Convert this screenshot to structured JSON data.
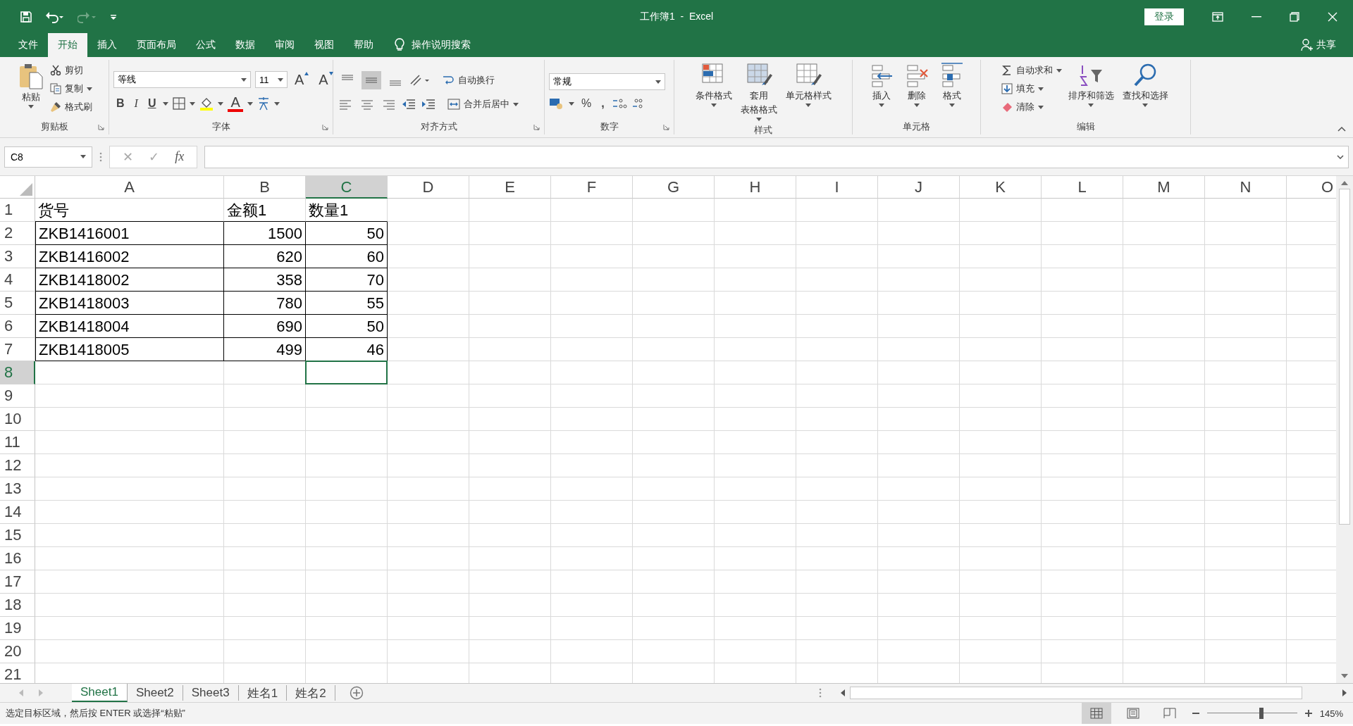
{
  "title_bar": {
    "title": "工作簿1  -  Excel",
    "sign_in": "登录"
  },
  "menu_tabs": [
    {
      "label": "文件",
      "selected": false
    },
    {
      "label": "开始",
      "selected": true
    },
    {
      "label": "插入",
      "selected": false
    },
    {
      "label": "页面布局",
      "selected": false
    },
    {
      "label": "公式",
      "selected": false
    },
    {
      "label": "数据",
      "selected": false
    },
    {
      "label": "审阅",
      "selected": false
    },
    {
      "label": "视图",
      "selected": false
    },
    {
      "label": "帮助",
      "selected": false
    }
  ],
  "tell_me": "操作说明搜索",
  "share": "共享",
  "ribbon": {
    "clipboard": {
      "label": "剪贴板",
      "paste": "粘贴",
      "cut": "剪切",
      "copy": "复制",
      "format_painter": "格式刷"
    },
    "font": {
      "label": "字体",
      "font_name": "等线",
      "font_size": "11",
      "grow": "A",
      "shrink": "A",
      "bold": "B",
      "italic": "I",
      "underline": "U",
      "font_color": "A"
    },
    "alignment": {
      "label": "对齐方式",
      "wrap_text": "自动换行",
      "merge_center": "合并后居中",
      "vertical": [
        {
          "selected": false
        },
        {
          "selected": true
        },
        {
          "selected": false
        }
      ]
    },
    "number": {
      "label": "数字",
      "format": "常规",
      "percent": "%",
      "comma": ","
    },
    "styles": {
      "label": "样式",
      "buttons": [
        {
          "lines": [
            "条件格式"
          ]
        },
        {
          "lines": [
            "套用",
            "表格格式"
          ]
        },
        {
          "lines": [
            "单元格样式"
          ]
        }
      ]
    },
    "cells": {
      "label": "单元格",
      "buttons": [
        "插入",
        "删除",
        "格式"
      ]
    },
    "editing": {
      "label": "编辑",
      "autosum": "自动求和",
      "fill": "填充",
      "clear": "清除",
      "sort_filter": "排序和筛选",
      "find_select": "查找和选择"
    }
  },
  "formula_bar": {
    "name_box": "C8",
    "cancel": "✕",
    "enter": "✓",
    "function": "fx"
  },
  "sheet": {
    "columns": [
      {
        "label": "A",
        "selected": false
      },
      {
        "label": "B",
        "selected": false
      },
      {
        "label": "C",
        "selected": true
      },
      {
        "label": "D",
        "selected": false
      },
      {
        "label": "E",
        "selected": false
      },
      {
        "label": "F",
        "selected": false
      },
      {
        "label": "G",
        "selected": false
      },
      {
        "label": "H",
        "selected": false
      },
      {
        "label": "I",
        "selected": false
      },
      {
        "label": "J",
        "selected": false
      },
      {
        "label": "K",
        "selected": false
      },
      {
        "label": "L",
        "selected": false
      },
      {
        "label": "M",
        "selected": false
      },
      {
        "label": "N",
        "selected": false
      },
      {
        "label": "O",
        "selected": false
      }
    ],
    "rows": [
      {
        "number": "1",
        "selected": false,
        "bordered": false,
        "cells": [
          {
            "text": "货号",
            "right_aligned": false
          },
          {
            "text": "金额1",
            "right_aligned": false
          },
          {
            "text": "数量1",
            "right_aligned": false
          }
        ]
      },
      {
        "number": "2",
        "selected": false,
        "bordered": true,
        "cells": [
          {
            "text": "ZKB1416001",
            "right_aligned": false
          },
          {
            "text": "1500",
            "right_aligned": true
          },
          {
            "text": "50",
            "right_aligned": true
          }
        ]
      },
      {
        "number": "3",
        "selected": false,
        "bordered": true,
        "cells": [
          {
            "text": "ZKB1416002",
            "right_aligned": false
          },
          {
            "text": "620",
            "right_aligned": true
          },
          {
            "text": "60",
            "right_aligned": true
          }
        ]
      },
      {
        "number": "4",
        "selected": false,
        "bordered": true,
        "cells": [
          {
            "text": "ZKB1418002",
            "right_aligned": false
          },
          {
            "text": "358",
            "right_aligned": true
          },
          {
            "text": "70",
            "right_aligned": true
          }
        ]
      },
      {
        "number": "5",
        "selected": false,
        "bordered": true,
        "cells": [
          {
            "text": "ZKB1418003",
            "right_aligned": false
          },
          {
            "text": "780",
            "right_aligned": true
          },
          {
            "text": "55",
            "right_aligned": true
          }
        ]
      },
      {
        "number": "6",
        "selected": false,
        "bordered": true,
        "cells": [
          {
            "text": "ZKB1418004",
            "right_aligned": false
          },
          {
            "text": "690",
            "right_aligned": true
          },
          {
            "text": "50",
            "right_aligned": true
          }
        ]
      },
      {
        "number": "7",
        "selected": false,
        "bordered": true,
        "cells": [
          {
            "text": "ZKB1418005",
            "right_aligned": false
          },
          {
            "text": "499",
            "right_aligned": true
          },
          {
            "text": "46",
            "right_aligned": true
          }
        ]
      },
      {
        "number": "8",
        "selected": true
      },
      {
        "number": "9",
        "selected": false
      },
      {
        "number": "10",
        "selected": false
      },
      {
        "number": "11",
        "selected": false
      },
      {
        "number": "12",
        "selected": false
      },
      {
        "number": "13",
        "selected": false
      },
      {
        "number": "14",
        "selected": false
      },
      {
        "number": "15",
        "selected": false
      },
      {
        "number": "16",
        "selected": false
      },
      {
        "number": "17",
        "selected": false
      },
      {
        "number": "18",
        "selected": false
      },
      {
        "number": "19",
        "selected": false
      },
      {
        "number": "20",
        "selected": false
      },
      {
        "number": "21",
        "selected": false
      }
    ]
  },
  "sheet_tabs": [
    {
      "label": "Sheet1",
      "selected": true
    },
    {
      "label": "Sheet2",
      "selected": false
    },
    {
      "label": "Sheet3",
      "selected": false
    },
    {
      "label": "姓名1",
      "selected": false
    },
    {
      "label": "姓名2",
      "selected": false
    }
  ],
  "status_bar": {
    "message": "选定目标区域，然后按 ENTER 或选择“粘贴”",
    "views": [
      {
        "kind": "normal",
        "selected": true
      },
      {
        "kind": "page_layout",
        "selected": false
      },
      {
        "kind": "page_break",
        "selected": false
      }
    ],
    "zoom": {
      "level": 0.6,
      "reading": "145%"
    }
  }
}
